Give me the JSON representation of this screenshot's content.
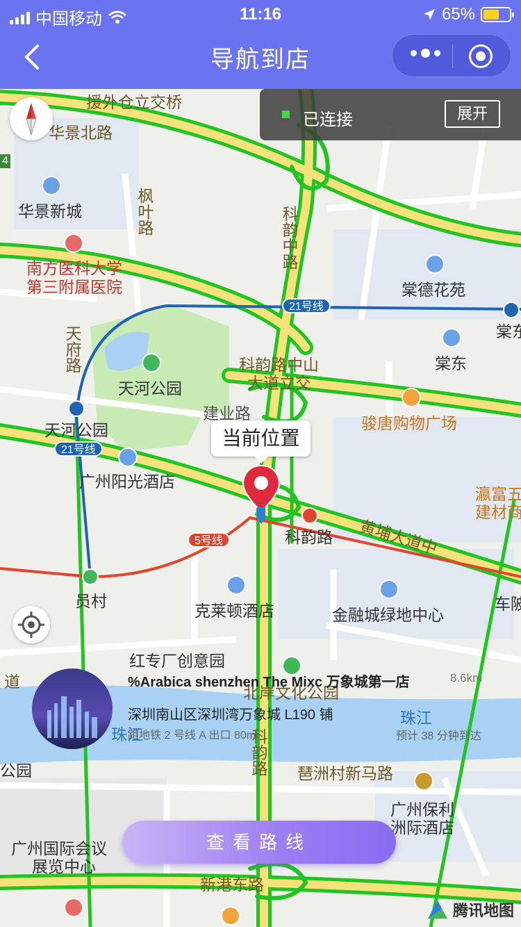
{
  "status_bar": {
    "carrier": "中国移动",
    "time": "11:16",
    "battery": "65%"
  },
  "header": {
    "title": "导航到店"
  },
  "connection": {
    "status": "已连接",
    "expand_label": "展开"
  },
  "map": {
    "current_location_label": "当前位置",
    "labels": {
      "yuanwai": "援外仓立交桥",
      "huajing_north": "华景北路",
      "huajing_xincheng": "华景新城",
      "fengye": "枫叶路",
      "hospital_1": "南方医科大学",
      "hospital_2": "第三附属医院",
      "keyun_zhong": "科韵中路",
      "tangde": "棠德花苑",
      "tangdong": "棠东",
      "tangdong_2": "棠东",
      "tianfu": "天府路",
      "tianhe_park": "天河公园",
      "keyun_interchange_1": "科韵路中山",
      "keyun_interchange_2": "大道立交",
      "jianye": "建业路",
      "juntang": "骏唐购物广场",
      "tianhe_park_station": "天河公园",
      "guangzhou_sunshine": "广州阳光酒店",
      "yingfu_1": "瀛富五",
      "yingfu_2": "建材商",
      "keyun_road": "科韵路",
      "huangpu": "黄埔大道中",
      "yuancun": "员村",
      "chebei": "车陂",
      "hilton": "克莱顿酒店",
      "jinrongcheng": "金融城绿地中心",
      "hongzhuanchang": "红专厂创意园",
      "beian": "北岸文化公园",
      "pearl_river": "珠江",
      "pearl_river_2": "珠江",
      "keyun_south": "科韵路",
      "pazhou_road": "琶洲村新马路",
      "baoli_1": "广州保利",
      "baoli_2": "洲际酒店",
      "convention_1": "广州国际会议",
      "convention_2": "展览中心",
      "xingang": "新港东路",
      "park_left": "公园",
      "dao_left": "道",
      "metro_21_a": "21号线",
      "metro_21_b": "21号线",
      "metro_5": "5号线",
      "side_4": "4"
    }
  },
  "store": {
    "name": "%Arabica shenzhen The Mixc 万象城第一店",
    "distance": "8.6km",
    "address": "深圳南山区深圳湾万象城 L190 铺",
    "metro": "距地铁 2 号线 A 出口 80m",
    "eta": "预计 38 分钟到达"
  },
  "route_button": "查看路线",
  "logo_text": "腾讯地图",
  "colors": {
    "header": "#6a74f0",
    "traffic_green": "#22c422",
    "road_yellow": "#f6e27c",
    "water": "#a8d1f4",
    "park": "#c8ebb5",
    "metro_blue": "#1f64b3",
    "metro_red": "#e0452f",
    "button_purple": "#9b7cf3"
  }
}
